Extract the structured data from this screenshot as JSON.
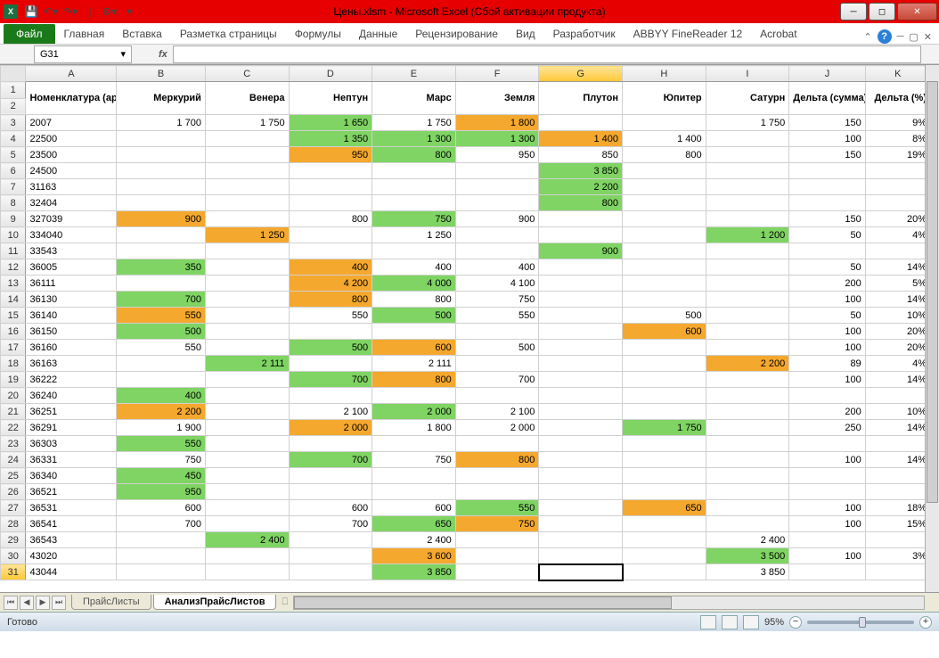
{
  "titlebar": {
    "title": "Цены.xlsm - Microsoft Excel (Сбой активации продукта)"
  },
  "ribbon": {
    "file": "Файл",
    "tabs": [
      "Главная",
      "Вставка",
      "Разметка страницы",
      "Формулы",
      "Данные",
      "Рецензирование",
      "Вид",
      "Разработчик",
      "ABBYY FineReader 12",
      "Acrobat"
    ]
  },
  "namebox": "G31",
  "columns": [
    "A",
    "B",
    "C",
    "D",
    "E",
    "F",
    "G",
    "H",
    "I",
    "J",
    "K"
  ],
  "headers": [
    "Номенклатура (артикул)",
    "Меркурий",
    "Венера",
    "Нептун",
    "Марс",
    "Земля",
    "Плутон",
    "Юпитер",
    "Сатурн",
    "Дельта (сумма)",
    "Дельта (%)"
  ],
  "selected_col": "G",
  "selected_row": 31,
  "rows": [
    {
      "n": 3,
      "c": [
        {
          "v": "2007",
          "a": "l"
        },
        {
          "v": "1 700"
        },
        {
          "v": "1 750"
        },
        {
          "v": "1 650",
          "cl": "green"
        },
        {
          "v": "1 750"
        },
        {
          "v": "1 800",
          "cl": "orange"
        },
        {
          "v": ""
        },
        {
          "v": ""
        },
        {
          "v": "1 750"
        },
        {
          "v": "150"
        },
        {
          "v": "9%"
        }
      ]
    },
    {
      "n": 4,
      "c": [
        {
          "v": "22500",
          "a": "l"
        },
        {
          "v": ""
        },
        {
          "v": ""
        },
        {
          "v": "1 350",
          "cl": "green"
        },
        {
          "v": "1 300",
          "cl": "green"
        },
        {
          "v": "1 300",
          "cl": "green"
        },
        {
          "v": "1 400",
          "cl": "orange"
        },
        {
          "v": "1 400"
        },
        {
          "v": ""
        },
        {
          "v": "100"
        },
        {
          "v": "8%"
        }
      ]
    },
    {
      "n": 5,
      "c": [
        {
          "v": "23500",
          "a": "l"
        },
        {
          "v": ""
        },
        {
          "v": ""
        },
        {
          "v": "950",
          "cl": "orange"
        },
        {
          "v": "800",
          "cl": "green"
        },
        {
          "v": "950"
        },
        {
          "v": "850"
        },
        {
          "v": "800"
        },
        {
          "v": ""
        },
        {
          "v": "150"
        },
        {
          "v": "19%"
        }
      ]
    },
    {
      "n": 6,
      "c": [
        {
          "v": "24500",
          "a": "l"
        },
        {
          "v": ""
        },
        {
          "v": ""
        },
        {
          "v": ""
        },
        {
          "v": ""
        },
        {
          "v": ""
        },
        {
          "v": "3 850",
          "cl": "green"
        },
        {
          "v": ""
        },
        {
          "v": ""
        },
        {
          "v": ""
        },
        {
          "v": ""
        }
      ]
    },
    {
      "n": 7,
      "c": [
        {
          "v": "31163",
          "a": "l"
        },
        {
          "v": ""
        },
        {
          "v": ""
        },
        {
          "v": ""
        },
        {
          "v": ""
        },
        {
          "v": ""
        },
        {
          "v": "2 200",
          "cl": "green"
        },
        {
          "v": ""
        },
        {
          "v": ""
        },
        {
          "v": ""
        },
        {
          "v": ""
        }
      ]
    },
    {
      "n": 8,
      "c": [
        {
          "v": "32404",
          "a": "l"
        },
        {
          "v": ""
        },
        {
          "v": ""
        },
        {
          "v": ""
        },
        {
          "v": ""
        },
        {
          "v": ""
        },
        {
          "v": "800",
          "cl": "green"
        },
        {
          "v": ""
        },
        {
          "v": ""
        },
        {
          "v": ""
        },
        {
          "v": ""
        }
      ]
    },
    {
      "n": 9,
      "c": [
        {
          "v": "327039",
          "a": "l"
        },
        {
          "v": "900",
          "cl": "orange"
        },
        {
          "v": ""
        },
        {
          "v": "800"
        },
        {
          "v": "750",
          "cl": "green"
        },
        {
          "v": "900"
        },
        {
          "v": ""
        },
        {
          "v": ""
        },
        {
          "v": ""
        },
        {
          "v": "150"
        },
        {
          "v": "20%"
        }
      ]
    },
    {
      "n": 10,
      "c": [
        {
          "v": "334040",
          "a": "l"
        },
        {
          "v": ""
        },
        {
          "v": "1 250",
          "cl": "orange"
        },
        {
          "v": ""
        },
        {
          "v": "1 250"
        },
        {
          "v": ""
        },
        {
          "v": ""
        },
        {
          "v": ""
        },
        {
          "v": "1 200",
          "cl": "green"
        },
        {
          "v": "50"
        },
        {
          "v": "4%"
        }
      ]
    },
    {
      "n": 11,
      "c": [
        {
          "v": "33543",
          "a": "l"
        },
        {
          "v": ""
        },
        {
          "v": ""
        },
        {
          "v": ""
        },
        {
          "v": ""
        },
        {
          "v": ""
        },
        {
          "v": "900",
          "cl": "green"
        },
        {
          "v": ""
        },
        {
          "v": ""
        },
        {
          "v": ""
        },
        {
          "v": ""
        }
      ]
    },
    {
      "n": 12,
      "c": [
        {
          "v": "36005",
          "a": "l"
        },
        {
          "v": "350",
          "cl": "green"
        },
        {
          "v": ""
        },
        {
          "v": "400",
          "cl": "orange"
        },
        {
          "v": "400"
        },
        {
          "v": "400"
        },
        {
          "v": ""
        },
        {
          "v": ""
        },
        {
          "v": ""
        },
        {
          "v": "50"
        },
        {
          "v": "14%"
        }
      ]
    },
    {
      "n": 13,
      "c": [
        {
          "v": "36111",
          "a": "l"
        },
        {
          "v": ""
        },
        {
          "v": ""
        },
        {
          "v": "4 200",
          "cl": "orange"
        },
        {
          "v": "4 000",
          "cl": "green"
        },
        {
          "v": "4 100"
        },
        {
          "v": ""
        },
        {
          "v": ""
        },
        {
          "v": ""
        },
        {
          "v": "200"
        },
        {
          "v": "5%"
        }
      ]
    },
    {
      "n": 14,
      "c": [
        {
          "v": "36130",
          "a": "l"
        },
        {
          "v": "700",
          "cl": "green"
        },
        {
          "v": ""
        },
        {
          "v": "800",
          "cl": "orange"
        },
        {
          "v": "800"
        },
        {
          "v": "750"
        },
        {
          "v": ""
        },
        {
          "v": ""
        },
        {
          "v": ""
        },
        {
          "v": "100"
        },
        {
          "v": "14%"
        }
      ]
    },
    {
      "n": 15,
      "c": [
        {
          "v": "36140",
          "a": "l"
        },
        {
          "v": "550",
          "cl": "orange"
        },
        {
          "v": ""
        },
        {
          "v": "550"
        },
        {
          "v": "500",
          "cl": "green"
        },
        {
          "v": "550"
        },
        {
          "v": ""
        },
        {
          "v": "500"
        },
        {
          "v": ""
        },
        {
          "v": "50"
        },
        {
          "v": "10%"
        }
      ]
    },
    {
      "n": 16,
      "c": [
        {
          "v": "36150",
          "a": "l"
        },
        {
          "v": "500",
          "cl": "green"
        },
        {
          "v": ""
        },
        {
          "v": ""
        },
        {
          "v": ""
        },
        {
          "v": ""
        },
        {
          "v": ""
        },
        {
          "v": "600",
          "cl": "orange"
        },
        {
          "v": ""
        },
        {
          "v": "100"
        },
        {
          "v": "20%"
        }
      ]
    },
    {
      "n": 17,
      "c": [
        {
          "v": "36160",
          "a": "l"
        },
        {
          "v": "550"
        },
        {
          "v": ""
        },
        {
          "v": "500",
          "cl": "green"
        },
        {
          "v": "600",
          "cl": "orange"
        },
        {
          "v": "500"
        },
        {
          "v": ""
        },
        {
          "v": ""
        },
        {
          "v": ""
        },
        {
          "v": "100"
        },
        {
          "v": "20%"
        }
      ]
    },
    {
      "n": 18,
      "c": [
        {
          "v": "36163",
          "a": "l"
        },
        {
          "v": ""
        },
        {
          "v": "2 111",
          "cl": "green"
        },
        {
          "v": ""
        },
        {
          "v": "2 111"
        },
        {
          "v": ""
        },
        {
          "v": ""
        },
        {
          "v": ""
        },
        {
          "v": "2 200",
          "cl": "orange"
        },
        {
          "v": "89"
        },
        {
          "v": "4%"
        }
      ]
    },
    {
      "n": 19,
      "c": [
        {
          "v": "36222",
          "a": "l"
        },
        {
          "v": ""
        },
        {
          "v": ""
        },
        {
          "v": "700",
          "cl": "green"
        },
        {
          "v": "800",
          "cl": "orange"
        },
        {
          "v": "700"
        },
        {
          "v": ""
        },
        {
          "v": ""
        },
        {
          "v": ""
        },
        {
          "v": "100"
        },
        {
          "v": "14%"
        }
      ]
    },
    {
      "n": 20,
      "c": [
        {
          "v": "36240",
          "a": "l"
        },
        {
          "v": "400",
          "cl": "green"
        },
        {
          "v": ""
        },
        {
          "v": ""
        },
        {
          "v": ""
        },
        {
          "v": ""
        },
        {
          "v": ""
        },
        {
          "v": ""
        },
        {
          "v": ""
        },
        {
          "v": ""
        },
        {
          "v": ""
        }
      ]
    },
    {
      "n": 21,
      "c": [
        {
          "v": "36251",
          "a": "l"
        },
        {
          "v": "2 200",
          "cl": "orange"
        },
        {
          "v": ""
        },
        {
          "v": "2 100"
        },
        {
          "v": "2 000",
          "cl": "green"
        },
        {
          "v": "2 100"
        },
        {
          "v": ""
        },
        {
          "v": ""
        },
        {
          "v": ""
        },
        {
          "v": "200"
        },
        {
          "v": "10%"
        }
      ]
    },
    {
      "n": 22,
      "c": [
        {
          "v": "36291",
          "a": "l"
        },
        {
          "v": "1 900"
        },
        {
          "v": ""
        },
        {
          "v": "2 000",
          "cl": "orange"
        },
        {
          "v": "1 800"
        },
        {
          "v": "2 000"
        },
        {
          "v": ""
        },
        {
          "v": "1 750",
          "cl": "green"
        },
        {
          "v": ""
        },
        {
          "v": "250"
        },
        {
          "v": "14%"
        }
      ]
    },
    {
      "n": 23,
      "c": [
        {
          "v": "36303",
          "a": "l"
        },
        {
          "v": "550",
          "cl": "green"
        },
        {
          "v": ""
        },
        {
          "v": ""
        },
        {
          "v": ""
        },
        {
          "v": ""
        },
        {
          "v": ""
        },
        {
          "v": ""
        },
        {
          "v": ""
        },
        {
          "v": ""
        },
        {
          "v": ""
        }
      ]
    },
    {
      "n": 24,
      "c": [
        {
          "v": "36331",
          "a": "l"
        },
        {
          "v": "750"
        },
        {
          "v": ""
        },
        {
          "v": "700",
          "cl": "green"
        },
        {
          "v": "750"
        },
        {
          "v": "800",
          "cl": "orange"
        },
        {
          "v": ""
        },
        {
          "v": ""
        },
        {
          "v": ""
        },
        {
          "v": "100"
        },
        {
          "v": "14%"
        }
      ]
    },
    {
      "n": 25,
      "c": [
        {
          "v": "36340",
          "a": "l"
        },
        {
          "v": "450",
          "cl": "green"
        },
        {
          "v": ""
        },
        {
          "v": ""
        },
        {
          "v": ""
        },
        {
          "v": ""
        },
        {
          "v": ""
        },
        {
          "v": ""
        },
        {
          "v": ""
        },
        {
          "v": ""
        },
        {
          "v": ""
        }
      ]
    },
    {
      "n": 26,
      "c": [
        {
          "v": "36521",
          "a": "l"
        },
        {
          "v": "950",
          "cl": "green"
        },
        {
          "v": ""
        },
        {
          "v": ""
        },
        {
          "v": ""
        },
        {
          "v": ""
        },
        {
          "v": ""
        },
        {
          "v": ""
        },
        {
          "v": ""
        },
        {
          "v": ""
        },
        {
          "v": ""
        }
      ]
    },
    {
      "n": 27,
      "c": [
        {
          "v": "36531",
          "a": "l"
        },
        {
          "v": "600"
        },
        {
          "v": ""
        },
        {
          "v": "600"
        },
        {
          "v": "600"
        },
        {
          "v": "550",
          "cl": "green"
        },
        {
          "v": ""
        },
        {
          "v": "650",
          "cl": "orange"
        },
        {
          "v": ""
        },
        {
          "v": "100"
        },
        {
          "v": "18%"
        }
      ]
    },
    {
      "n": 28,
      "c": [
        {
          "v": "36541",
          "a": "l"
        },
        {
          "v": "700"
        },
        {
          "v": ""
        },
        {
          "v": "700"
        },
        {
          "v": "650",
          "cl": "green"
        },
        {
          "v": "750",
          "cl": "orange"
        },
        {
          "v": ""
        },
        {
          "v": ""
        },
        {
          "v": ""
        },
        {
          "v": "100"
        },
        {
          "v": "15%"
        }
      ]
    },
    {
      "n": 29,
      "c": [
        {
          "v": "36543",
          "a": "l"
        },
        {
          "v": ""
        },
        {
          "v": "2 400",
          "cl": "green"
        },
        {
          "v": ""
        },
        {
          "v": "2 400"
        },
        {
          "v": ""
        },
        {
          "v": ""
        },
        {
          "v": ""
        },
        {
          "v": "2 400"
        },
        {
          "v": ""
        },
        {
          "v": ""
        }
      ]
    },
    {
      "n": 30,
      "c": [
        {
          "v": "43020",
          "a": "l"
        },
        {
          "v": ""
        },
        {
          "v": ""
        },
        {
          "v": ""
        },
        {
          "v": "3 600",
          "cl": "orange"
        },
        {
          "v": ""
        },
        {
          "v": ""
        },
        {
          "v": ""
        },
        {
          "v": "3 500",
          "cl": "green"
        },
        {
          "v": "100"
        },
        {
          "v": "3%"
        }
      ]
    },
    {
      "n": 31,
      "c": [
        {
          "v": "43044",
          "a": "l"
        },
        {
          "v": ""
        },
        {
          "v": ""
        },
        {
          "v": ""
        },
        {
          "v": "3 850",
          "cl": "green"
        },
        {
          "v": ""
        },
        {
          "v": "",
          "sel": true
        },
        {
          "v": ""
        },
        {
          "v": "3 850"
        },
        {
          "v": ""
        },
        {
          "v": ""
        }
      ]
    }
  ],
  "sheets": {
    "inactive": "ПрайсЛисты",
    "active": "АнализПрайсЛистов"
  },
  "status": {
    "ready": "Готово",
    "zoom": "95%"
  }
}
